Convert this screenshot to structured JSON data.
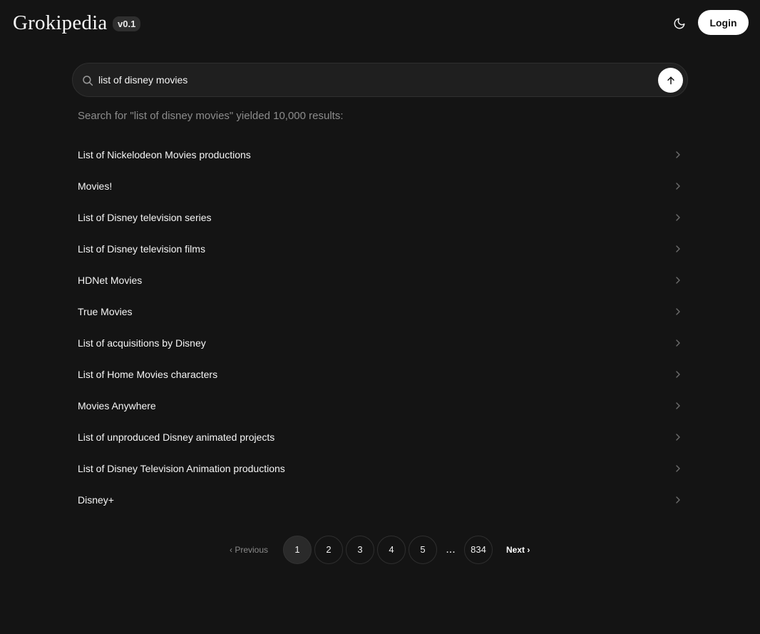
{
  "header": {
    "logo": "Grokipedia",
    "version": "v0.1",
    "theme_icon": "moon-icon",
    "login_label": "Login"
  },
  "search": {
    "value": "list of disney movies",
    "placeholder": "",
    "search_icon": "search-icon",
    "submit_icon": "arrow-up-icon"
  },
  "results": {
    "summary": "Search for \"list of disney movies\" yielded 10,000 results:",
    "items": [
      {
        "title": "List of Nickelodeon Movies productions"
      },
      {
        "title": "Movies!"
      },
      {
        "title": "List of Disney television series"
      },
      {
        "title": "List of Disney television films"
      },
      {
        "title": "HDNet Movies"
      },
      {
        "title": "True Movies"
      },
      {
        "title": "List of acquisitions by Disney"
      },
      {
        "title": "List of Home Movies characters"
      },
      {
        "title": "Movies Anywhere"
      },
      {
        "title": "List of unproduced Disney animated projects"
      },
      {
        "title": "List of Disney Television Animation productions"
      },
      {
        "title": "Disney+"
      }
    ]
  },
  "pagination": {
    "previous_label": "‹ Previous",
    "next_label": "Next ›",
    "pages": [
      "1",
      "2",
      "3",
      "4",
      "5"
    ],
    "ellipsis": "...",
    "last_page": "834",
    "current_page": "1"
  },
  "colors": {
    "background": "#141414",
    "text": "#f5f5f5",
    "muted_text": "#8c8c8c",
    "search_bg": "#1f1f1f",
    "button_bg": "#ffffff"
  }
}
